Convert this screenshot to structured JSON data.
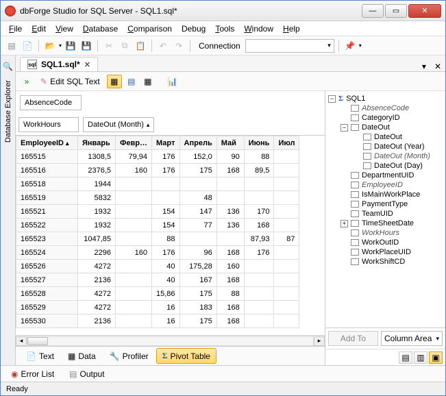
{
  "window": {
    "title": "dbForge Studio for SQL Server - SQL1.sql*"
  },
  "menu": {
    "file": "File",
    "edit": "Edit",
    "view": "View",
    "database": "Database",
    "comparison": "Comparison",
    "debug": "Debug",
    "tools": "Tools",
    "window": "Window",
    "help": "Help"
  },
  "toolbar": {
    "connection_label": "Connection"
  },
  "leftdock": {
    "tab": "Database Explorer"
  },
  "filetab": {
    "label": "SQL1.sql*"
  },
  "subtoolbar": {
    "edit_link": "Edit SQL Text"
  },
  "pivot": {
    "filter": "AbsenceCode",
    "row_field": "WorkHours",
    "col_field": "DateOut (Month)",
    "data_field": "EmployeeID",
    "columns": [
      "Январь",
      "Февр…",
      "Март",
      "Апрель",
      "Май",
      "Июнь",
      "Июл"
    ],
    "rows": [
      {
        "h": "165515",
        "c": [
          "1308,5",
          "79,94",
          "176",
          "152,0",
          "90",
          "88",
          ""
        ]
      },
      {
        "h": "165516",
        "c": [
          "2376,5",
          "160",
          "176",
          "175",
          "168",
          "89,5",
          ""
        ]
      },
      {
        "h": "165518",
        "c": [
          "1944",
          "",
          "",
          "",
          "",
          "",
          ""
        ]
      },
      {
        "h": "165519",
        "c": [
          "5832",
          "",
          "",
          "48",
          "",
          "",
          ""
        ]
      },
      {
        "h": "165521",
        "c": [
          "1932",
          "",
          "154",
          "147",
          "136",
          "170",
          ""
        ]
      },
      {
        "h": "165522",
        "c": [
          "1932",
          "",
          "154",
          "77",
          "136",
          "168",
          ""
        ]
      },
      {
        "h": "165523",
        "c": [
          "1047,85",
          "",
          "88",
          "",
          "",
          "87,93",
          "87"
        ]
      },
      {
        "h": "165524",
        "c": [
          "2296",
          "160",
          "176",
          "96",
          "168",
          "176",
          ""
        ]
      },
      {
        "h": "165526",
        "c": [
          "4272",
          "",
          "40",
          "175,28",
          "160",
          "",
          ""
        ]
      },
      {
        "h": "165527",
        "c": [
          "2136",
          "",
          "40",
          "167",
          "168",
          "",
          ""
        ]
      },
      {
        "h": "165528",
        "c": [
          "4272",
          "",
          "15,86",
          "175",
          "88",
          "",
          ""
        ]
      },
      {
        "h": "165529",
        "c": [
          "4272",
          "",
          "16",
          "183",
          "168",
          "",
          ""
        ]
      },
      {
        "h": "165530",
        "c": [
          "2136",
          "",
          "16",
          "175",
          "168",
          "",
          ""
        ]
      }
    ]
  },
  "bottom_tabs": {
    "text": "Text",
    "data": "Data",
    "profiler": "Profiler",
    "pivot": "Pivot Table"
  },
  "tree": {
    "root": "SQL1",
    "nodes": [
      {
        "lvl": 1,
        "t": "AbsenceCode",
        "italic": true
      },
      {
        "lvl": 1,
        "t": "CategoryID"
      },
      {
        "lvl": 1,
        "t": "DateOut",
        "exp": "minus"
      },
      {
        "lvl": 2,
        "t": "DateOut"
      },
      {
        "lvl": 2,
        "t": "DateOut (Year)"
      },
      {
        "lvl": 2,
        "t": "DateOut (Month)",
        "italic": true
      },
      {
        "lvl": 2,
        "t": "DateOut (Day)"
      },
      {
        "lvl": 1,
        "t": "DepartmentUID"
      },
      {
        "lvl": 1,
        "t": "EmployeeID",
        "italic": true
      },
      {
        "lvl": 1,
        "t": "IsMainWorkPlace"
      },
      {
        "lvl": 1,
        "t": "PaymentType"
      },
      {
        "lvl": 1,
        "t": "TeamUID"
      },
      {
        "lvl": 1,
        "t": "TimeSheetDate",
        "exp": "plus"
      },
      {
        "lvl": 1,
        "t": "WorkHours",
        "italic": true
      },
      {
        "lvl": 1,
        "t": "WorkOutID"
      },
      {
        "lvl": 1,
        "t": "WorkPlaceUID"
      },
      {
        "lvl": 1,
        "t": "WorkShiftCD"
      }
    ]
  },
  "right_footer": {
    "addto": "Add To",
    "area": "Column Area"
  },
  "bottom_strip": {
    "error": "Error List",
    "output": "Output"
  },
  "status": {
    "text": "Ready"
  }
}
